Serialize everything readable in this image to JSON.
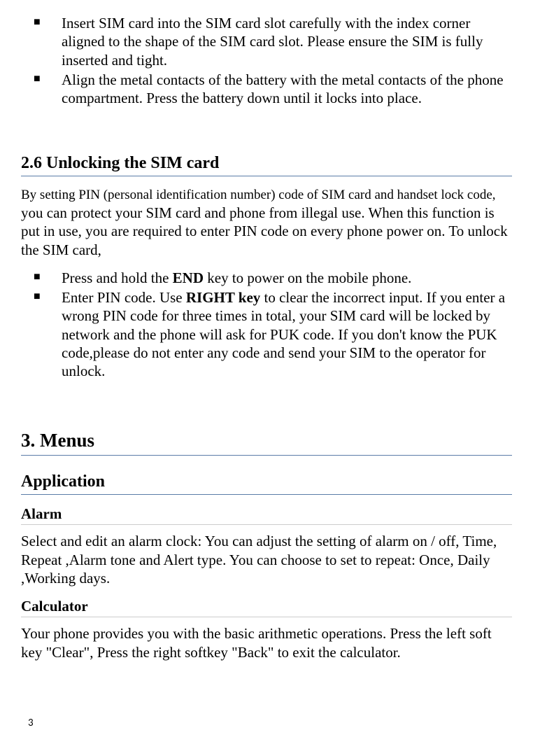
{
  "topBullets": [
    "Insert SIM card into the SIM card slot carefully with the index corner aligned to the shape of the SIM card slot. Please ensure the SIM is fully inserted and tight.",
    "Align the metal contacts of the battery with the metal contacts of the phone compartment. Press the battery down until it locks into place."
  ],
  "section26": {
    "title": "2.6 Unlocking the SIM card",
    "introPart1": "By setting PIN (personal identification number) code of SIM card and handset lock code,",
    "introPart2": " you can protect your SIM card and phone from illegal use. When this function is put in use, you are required to enter PIN code on every phone power on. To unlock the SIM card,",
    "bullet1a": "Press and hold the ",
    "bullet1b": "END",
    "bullet1c": " key to power on the mobile phone.",
    "bullet2a": "Enter PIN code. Use ",
    "bullet2b": "RIGHT key",
    "bullet2c": " to clear the incorrect input. If you enter a wrong PIN code for three times in total, your SIM card will be locked by network and the phone will ask for PUK code. If you don't know the PUK code,please do not enter any code and send your SIM to the operator for unlock."
  },
  "menus": {
    "title": "3. Menus",
    "applicationTitle": "Application",
    "alarm": {
      "title": "Alarm",
      "text": "Select and edit an alarm clock: You can adjust the setting of alarm on / off, Time, Repeat ,Alarm tone and Alert type. You can choose to set to repeat: Once, Daily ,Working days."
    },
    "calculator": {
      "title": "Calculator",
      "text": "Your phone provides you with the basic arithmetic operations. Press the left soft key \"Clear\", Press the right softkey \"Back\" to exit the calculator."
    }
  },
  "pageNumber": "3"
}
